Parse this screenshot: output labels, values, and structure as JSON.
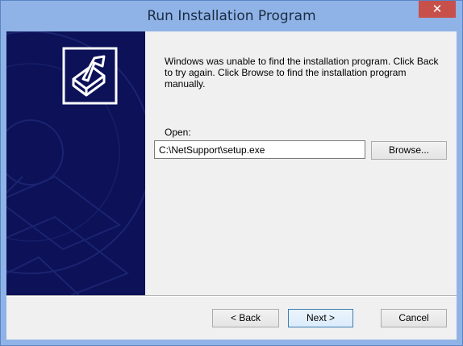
{
  "window": {
    "title": "Run Installation Program",
    "close_label": "✕"
  },
  "content": {
    "message": "Windows was unable to find the installation program.  Click Back to try again.  Click Browse to find the installation program manually.",
    "open_label": "Open:",
    "path_value": "C:\\NetSupport\\setup.exe"
  },
  "buttons": {
    "browse": "Browse...",
    "back": "< Back",
    "next": "Next >",
    "cancel": "Cancel"
  },
  "colors": {
    "titlebar": "#8fb3e6",
    "side_panel": "#0c1158",
    "close": "#c7504a"
  },
  "icons": {
    "wizard_logo": "install-arrow-box-icon",
    "close": "close-icon"
  }
}
